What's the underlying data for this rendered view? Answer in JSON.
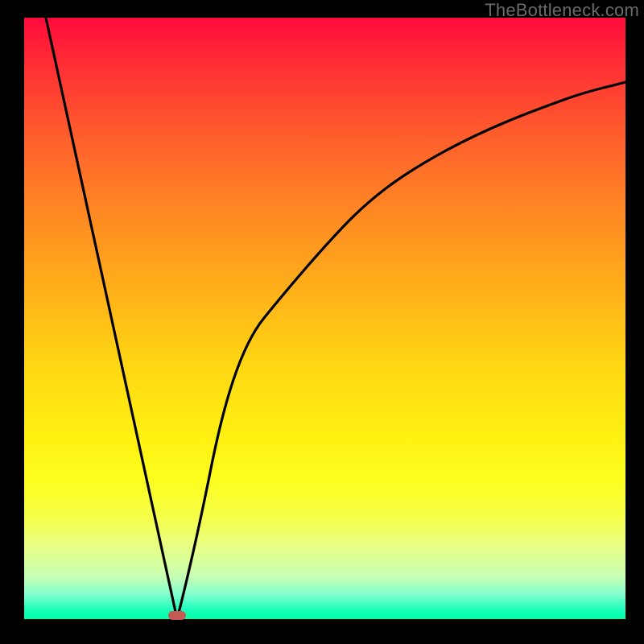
{
  "watermark": "TheBottleneck.com",
  "chart_data": {
    "type": "line",
    "title": "",
    "xlabel": "",
    "ylabel": "",
    "xlim": [
      0,
      100
    ],
    "ylim": [
      0,
      100
    ],
    "grid": false,
    "legend": false,
    "series": [
      {
        "name": "left-edge",
        "x": [
          3.6,
          25.5
        ],
        "values": [
          100,
          0
        ]
      },
      {
        "name": "right-curve",
        "x": [
          25.5,
          28,
          31,
          35,
          40,
          46,
          53,
          61,
          70,
          80,
          90,
          100
        ],
        "values": [
          0,
          12,
          25,
          38,
          50,
          60,
          68.5,
          75,
          80,
          83.8,
          86.8,
          89.2
        ]
      }
    ],
    "marker": {
      "x": 25.5,
      "y": 0,
      "color": "#c45a54"
    },
    "background_gradient": {
      "top": "#ff0b3c",
      "bottom": "#00ffa7",
      "stops": [
        "red",
        "orange",
        "yellow",
        "green"
      ]
    }
  }
}
